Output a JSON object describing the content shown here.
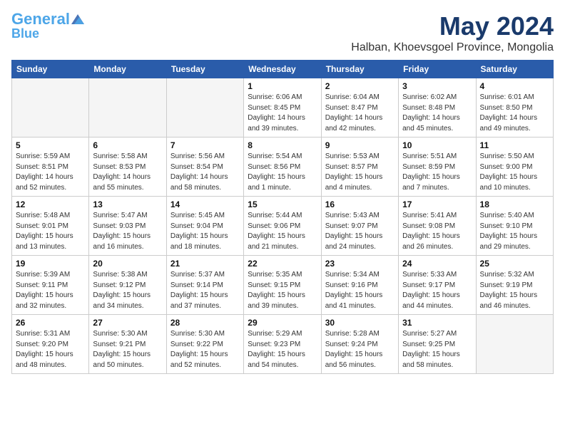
{
  "header": {
    "logo": {
      "line1": "General",
      "line2": "Blue"
    },
    "title": "May 2024",
    "subtitle": "Halban, Khoevsgoel Province, Mongolia"
  },
  "weekdays": [
    "Sunday",
    "Monday",
    "Tuesday",
    "Wednesday",
    "Thursday",
    "Friday",
    "Saturday"
  ],
  "weeks": [
    [
      {
        "day": "",
        "info": ""
      },
      {
        "day": "",
        "info": ""
      },
      {
        "day": "",
        "info": ""
      },
      {
        "day": "1",
        "info": "Sunrise: 6:06 AM\nSunset: 8:45 PM\nDaylight: 14 hours\nand 39 minutes."
      },
      {
        "day": "2",
        "info": "Sunrise: 6:04 AM\nSunset: 8:47 PM\nDaylight: 14 hours\nand 42 minutes."
      },
      {
        "day": "3",
        "info": "Sunrise: 6:02 AM\nSunset: 8:48 PM\nDaylight: 14 hours\nand 45 minutes."
      },
      {
        "day": "4",
        "info": "Sunrise: 6:01 AM\nSunset: 8:50 PM\nDaylight: 14 hours\nand 49 minutes."
      }
    ],
    [
      {
        "day": "5",
        "info": "Sunrise: 5:59 AM\nSunset: 8:51 PM\nDaylight: 14 hours\nand 52 minutes."
      },
      {
        "day": "6",
        "info": "Sunrise: 5:58 AM\nSunset: 8:53 PM\nDaylight: 14 hours\nand 55 minutes."
      },
      {
        "day": "7",
        "info": "Sunrise: 5:56 AM\nSunset: 8:54 PM\nDaylight: 14 hours\nand 58 minutes."
      },
      {
        "day": "8",
        "info": "Sunrise: 5:54 AM\nSunset: 8:56 PM\nDaylight: 15 hours\nand 1 minute."
      },
      {
        "day": "9",
        "info": "Sunrise: 5:53 AM\nSunset: 8:57 PM\nDaylight: 15 hours\nand 4 minutes."
      },
      {
        "day": "10",
        "info": "Sunrise: 5:51 AM\nSunset: 8:59 PM\nDaylight: 15 hours\nand 7 minutes."
      },
      {
        "day": "11",
        "info": "Sunrise: 5:50 AM\nSunset: 9:00 PM\nDaylight: 15 hours\nand 10 minutes."
      }
    ],
    [
      {
        "day": "12",
        "info": "Sunrise: 5:48 AM\nSunset: 9:01 PM\nDaylight: 15 hours\nand 13 minutes."
      },
      {
        "day": "13",
        "info": "Sunrise: 5:47 AM\nSunset: 9:03 PM\nDaylight: 15 hours\nand 16 minutes."
      },
      {
        "day": "14",
        "info": "Sunrise: 5:45 AM\nSunset: 9:04 PM\nDaylight: 15 hours\nand 18 minutes."
      },
      {
        "day": "15",
        "info": "Sunrise: 5:44 AM\nSunset: 9:06 PM\nDaylight: 15 hours\nand 21 minutes."
      },
      {
        "day": "16",
        "info": "Sunrise: 5:43 AM\nSunset: 9:07 PM\nDaylight: 15 hours\nand 24 minutes."
      },
      {
        "day": "17",
        "info": "Sunrise: 5:41 AM\nSunset: 9:08 PM\nDaylight: 15 hours\nand 26 minutes."
      },
      {
        "day": "18",
        "info": "Sunrise: 5:40 AM\nSunset: 9:10 PM\nDaylight: 15 hours\nand 29 minutes."
      }
    ],
    [
      {
        "day": "19",
        "info": "Sunrise: 5:39 AM\nSunset: 9:11 PM\nDaylight: 15 hours\nand 32 minutes."
      },
      {
        "day": "20",
        "info": "Sunrise: 5:38 AM\nSunset: 9:12 PM\nDaylight: 15 hours\nand 34 minutes."
      },
      {
        "day": "21",
        "info": "Sunrise: 5:37 AM\nSunset: 9:14 PM\nDaylight: 15 hours\nand 37 minutes."
      },
      {
        "day": "22",
        "info": "Sunrise: 5:35 AM\nSunset: 9:15 PM\nDaylight: 15 hours\nand 39 minutes."
      },
      {
        "day": "23",
        "info": "Sunrise: 5:34 AM\nSunset: 9:16 PM\nDaylight: 15 hours\nand 41 minutes."
      },
      {
        "day": "24",
        "info": "Sunrise: 5:33 AM\nSunset: 9:17 PM\nDaylight: 15 hours\nand 44 minutes."
      },
      {
        "day": "25",
        "info": "Sunrise: 5:32 AM\nSunset: 9:19 PM\nDaylight: 15 hours\nand 46 minutes."
      }
    ],
    [
      {
        "day": "26",
        "info": "Sunrise: 5:31 AM\nSunset: 9:20 PM\nDaylight: 15 hours\nand 48 minutes."
      },
      {
        "day": "27",
        "info": "Sunrise: 5:30 AM\nSunset: 9:21 PM\nDaylight: 15 hours\nand 50 minutes."
      },
      {
        "day": "28",
        "info": "Sunrise: 5:30 AM\nSunset: 9:22 PM\nDaylight: 15 hours\nand 52 minutes."
      },
      {
        "day": "29",
        "info": "Sunrise: 5:29 AM\nSunset: 9:23 PM\nDaylight: 15 hours\nand 54 minutes."
      },
      {
        "day": "30",
        "info": "Sunrise: 5:28 AM\nSunset: 9:24 PM\nDaylight: 15 hours\nand 56 minutes."
      },
      {
        "day": "31",
        "info": "Sunrise: 5:27 AM\nSunset: 9:25 PM\nDaylight: 15 hours\nand 58 minutes."
      },
      {
        "day": "",
        "info": ""
      }
    ]
  ]
}
